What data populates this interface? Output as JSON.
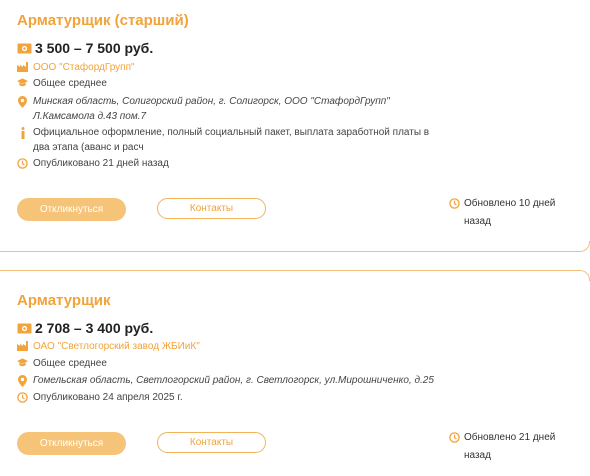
{
  "colors": {
    "accent": "#f2a33a",
    "button_fill": "#f6c478",
    "divider": "#f3c27a"
  },
  "vacancies": [
    {
      "title": "Арматурщик (старший)",
      "salary": "3 500 – 7 500 руб.",
      "company": "ООО \"СтафордГрупп\"",
      "education": "Общее среднее",
      "address": "Минская область, Солигорский район, г. Солигорск, ООО \"СтафордГрупп\" Л.Камсамола д.43 пом.7",
      "info": "Официальное оформление, полный социальный пакет, выплата заработной платы в два этапа (аванс и расч",
      "published": "Опубликовано 21 дней назад",
      "respond_label": "Откликнуться",
      "contacts_label": "Контакты",
      "updated": "Обновлено 10 дней назад"
    },
    {
      "title": "Арматурщик",
      "salary": "2 708 – 3 400 руб.",
      "company": "ОАО \"Светлогорский завод ЖБИиК\"",
      "education": "Общее среднее",
      "address": "Гомельская область, Светлогорский район, г. Светлогорск, ул.Мирошниченко, д.25",
      "published": "Опубликовано 24 апреля 2025 г.",
      "respond_label": "Откликнуться",
      "contacts_label": "Контакты",
      "updated": "Обновлено 21 дней назад"
    }
  ],
  "icons": {
    "salary": "money-icon",
    "company": "factory-icon",
    "education": "graduation-cap-icon",
    "address": "location-pin-icon",
    "info": "info-icon",
    "published": "clock-icon",
    "updated": "clock-icon"
  }
}
